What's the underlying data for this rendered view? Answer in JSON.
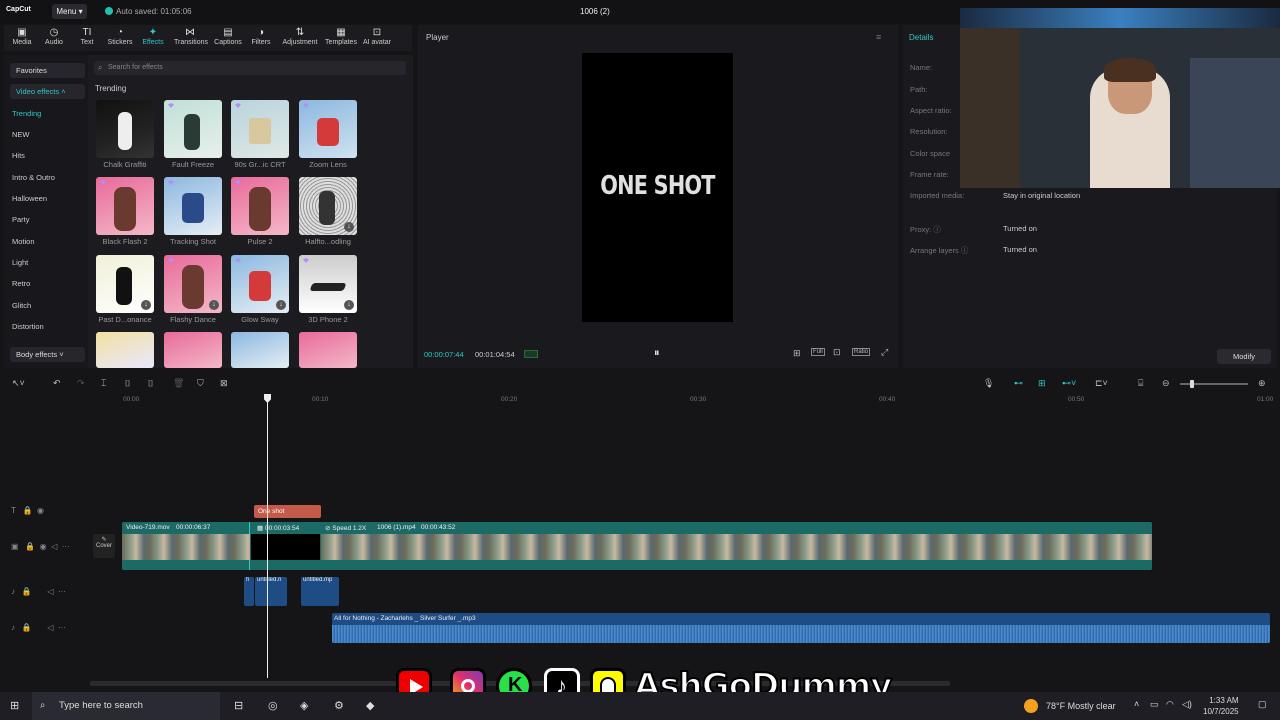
{
  "app": {
    "logo": "CapCut",
    "menu": "Menu",
    "autosave": "Auto saved: 01:05:06",
    "project_title": "1006 (2)"
  },
  "toolbar": {
    "items": [
      {
        "label": "Media",
        "icon": "media-icon"
      },
      {
        "label": "Audio",
        "icon": "audio-icon"
      },
      {
        "label": "Text",
        "icon": "text-icon"
      },
      {
        "label": "Stickers",
        "icon": "sticker-icon"
      },
      {
        "label": "Effects",
        "icon": "effects-icon",
        "active": true
      },
      {
        "label": "Transitions",
        "icon": "transition-icon"
      },
      {
        "label": "Captions",
        "icon": "captions-icon"
      },
      {
        "label": "Filters",
        "icon": "filter-icon"
      },
      {
        "label": "Adjustment",
        "icon": "adjust-icon"
      },
      {
        "label": "Templates",
        "icon": "templates-icon"
      },
      {
        "label": "AI avatar",
        "icon": "avatar-icon"
      }
    ]
  },
  "leftnav": {
    "favorites": "Favorites",
    "video_effects": "Video effects",
    "body_effects": "Body effects",
    "items": [
      "Trending",
      "NEW",
      "Hits",
      "Intro & Outro",
      "Halloween",
      "Party",
      "Motion",
      "Light",
      "Retro",
      "Glitch",
      "Distortion"
    ]
  },
  "effects": {
    "search_placeholder": "Search for effects",
    "section": "Trending",
    "cards": [
      "Chalk Graffiti",
      "Fault Freeze",
      "90s Gr...ic CRT",
      "Zoom Lens",
      "Black Flash 2",
      "Tracking Shot",
      "Pulse 2",
      "Halfto...odling",
      "Past D...onance",
      "Flashy Dance",
      "Glow Sway",
      "3D Phone 2"
    ]
  },
  "player": {
    "title": "Player",
    "screen_text": "ONE SHOT",
    "current_time": "00:00:07:44",
    "total_time": "00:01:04:54",
    "ctrl_full": "Full",
    "ctrl_ratio": "Ratio"
  },
  "details": {
    "title": "Details",
    "rows": [
      {
        "label": "Name:",
        "value": ""
      },
      {
        "label": "Path:",
        "value": ""
      },
      {
        "label": "Aspect ratio:",
        "value": ""
      },
      {
        "label": "Resolution:",
        "value": ""
      },
      {
        "label": "Color space",
        "value": ""
      },
      {
        "label": "Frame rate:",
        "value": ""
      },
      {
        "label": "Imported media:",
        "value": "Stay in original location"
      },
      {
        "label": "Proxy:",
        "value": "Turned on"
      },
      {
        "label": "Arrange layers",
        "value": "Turned on"
      }
    ],
    "modify": "Modify"
  },
  "ruler": [
    "00:00",
    "00:10",
    "00:20",
    "00:30",
    "00:40",
    "00:50",
    "01:00"
  ],
  "timeline": {
    "text_clip": "One shot",
    "cover": "Cover",
    "clip1_name": "Video-719.mov",
    "clip1_dur": "00:00:06:37",
    "clip2_dur": "00:00:03:54",
    "clip3_speed": "Speed 1.2X",
    "clip3_name": "1006 (1).mp4",
    "clip3_dur": "00:00:43:52",
    "sfx1": "untitled.n",
    "sfx2": "untitled.mp",
    "sfx0": "fi",
    "audio": "All for Nothing - Zacharlehs _ Silver Surfer _.mp3"
  },
  "overlay": {
    "brand": "AshGoDummy"
  },
  "taskbar": {
    "search": "Type here to search",
    "weather": "78°F  Mostly clear",
    "time": "1:33 AM",
    "date": "10/7/2025"
  },
  "colors": {
    "accent": "#2ec8c8",
    "video_clip": "#1b6a66",
    "audio_clip": "#1e4d86",
    "text_clip": "#c45a4a"
  }
}
